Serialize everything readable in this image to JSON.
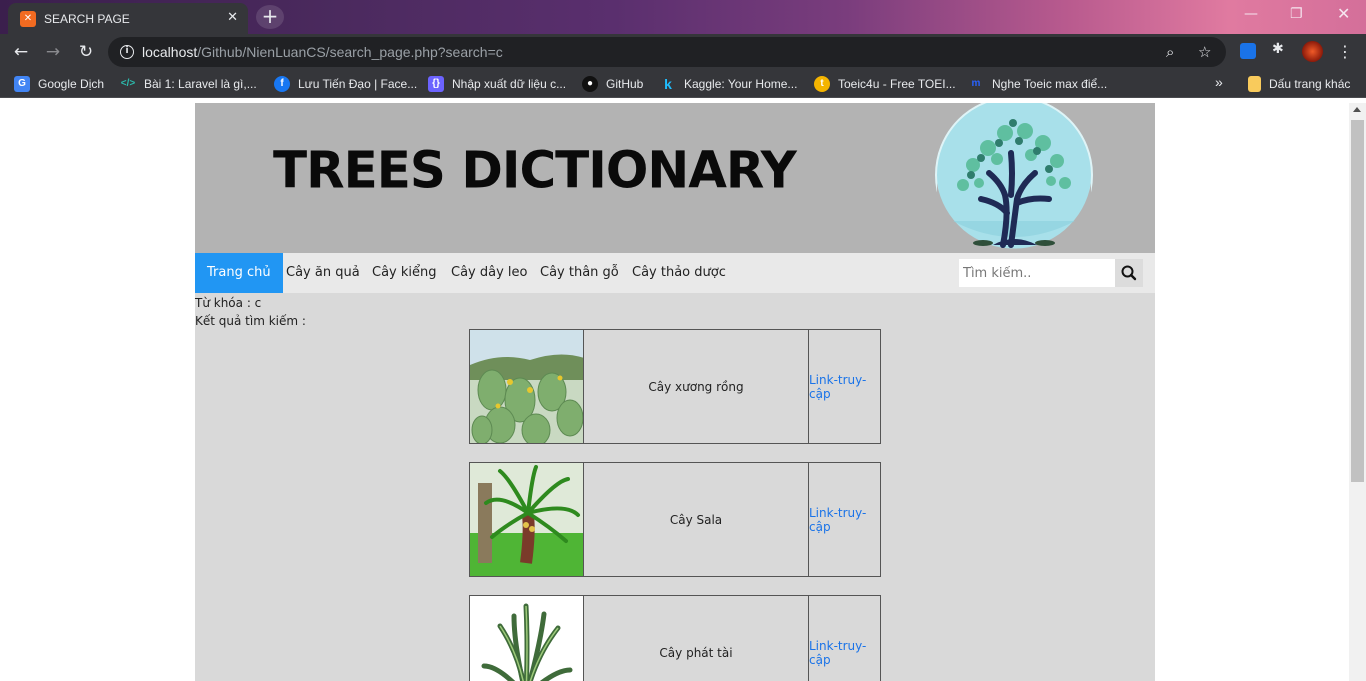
{
  "browser": {
    "tab_title": "SEARCH PAGE",
    "url_host": "localhost",
    "url_path": "/Github/NienLuanCS/search_page.php?search=c",
    "bookmarks": [
      {
        "label": "Google Dịch",
        "icon": "google-translate-icon",
        "color": "#4285f4"
      },
      {
        "label": "Bài 1: Laravel là gì,...",
        "icon": "code-icon",
        "color": "#2bbbad"
      },
      {
        "label": "Lưu Tiến Đạo | Face...",
        "icon": "facebook-icon",
        "color": "#1877f2"
      },
      {
        "label": "Nhập xuất dữ liệu c...",
        "icon": "code-brackets-icon",
        "color": "#6c63ff"
      },
      {
        "label": "GitHub",
        "icon": "github-icon",
        "color": "#24292e"
      },
      {
        "label": "Kaggle: Your Home...",
        "icon": "kaggle-icon",
        "color": "#20beff"
      },
      {
        "label": "Toeic4u - Free TOEI...",
        "icon": "toeic4u-icon",
        "color": "#f4b400"
      },
      {
        "label": "Nghe Toeic max điể...",
        "icon": "toeic-max-icon",
        "color": "#2962ff"
      }
    ],
    "other_bookmarks": "Dấu trang khác"
  },
  "site": {
    "banner_title": "TREES DICTIONARY",
    "nav": [
      {
        "label": "Trang chủ",
        "active": true
      },
      {
        "label": "Cây ăn quả"
      },
      {
        "label": "Cây kiểng"
      },
      {
        "label": "Cây dây leo"
      },
      {
        "label": "Cây thân gỗ"
      },
      {
        "label": "Cây thảo dược"
      }
    ],
    "search_placeholder": "Tìm kiếm..",
    "keyword_line": "Từ khóa : c",
    "results_label": "Kết quả tìm kiếm :",
    "results": [
      {
        "name": "Cây xương rồng",
        "link": "Link-truy-cập",
        "image": "cactus-photo"
      },
      {
        "name": "Cây Sala",
        "link": "Link-truy-cập",
        "image": "sala-palm-photo"
      },
      {
        "name": "Cây phát tài",
        "link": "Link-truy-cập",
        "image": "dracaena-photo"
      }
    ]
  },
  "colors": {
    "nav_active": "#2196f3",
    "banner_bg": "#b3b3b3",
    "content_bg": "#d9d9d9",
    "link": "#1a73e8"
  }
}
